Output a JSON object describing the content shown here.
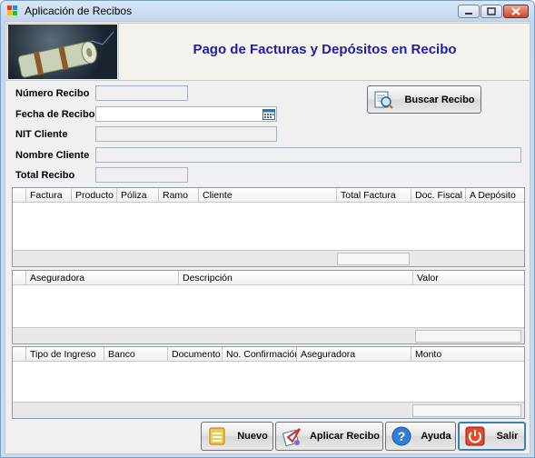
{
  "window": {
    "title": "Aplicación de Recibos"
  },
  "banner": {
    "title": "Pago de Facturas  y Depósitos en Recibo"
  },
  "form": {
    "numero_recibo_label": "Número Recibo",
    "fecha_recibo_label": "Fecha de Recibo",
    "nit_cliente_label": "NIT Cliente",
    "nombre_cliente_label": "Nombre Cliente",
    "total_recibo_label": "Total Recibo",
    "numero_recibo_value": "",
    "fecha_recibo_value": "",
    "nit_cliente_value": "",
    "nombre_cliente_value": "",
    "total_recibo_value": ""
  },
  "buscar_button": {
    "label": "Buscar Recibo"
  },
  "facturas_grid": {
    "columns": [
      "Factura",
      "Producto",
      "Póliza",
      "Ramo",
      "Cliente",
      "Total Factura",
      "Doc. Fiscal",
      "A Depósito"
    ]
  },
  "valores_grid": {
    "columns": [
      "Aseguradora",
      "Descripción",
      "Valor"
    ]
  },
  "ingresos_grid": {
    "columns": [
      "Tipo de Ingreso",
      "Banco",
      "Documento",
      "No. Confirmación",
      "Aseguradora",
      "Monto"
    ]
  },
  "actions": {
    "nuevo": "Nuevo",
    "aplicar": "Aplicar Recibo",
    "ayuda": "Ayuda",
    "salir": "Salir"
  }
}
